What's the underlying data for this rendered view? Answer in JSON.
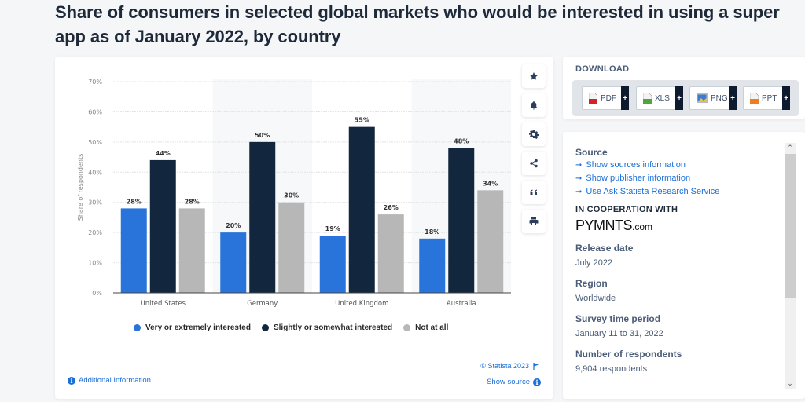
{
  "page": {
    "title": "Share of consumers in selected global markets who would be interested in using a super app as of January 2022, by country"
  },
  "chart_data": {
    "type": "bar",
    "title": "Share of consumers in selected global markets who would be interested in using a super app as of January 2022, by country",
    "xlabel": "",
    "ylabel": "Share of respondents",
    "categories": [
      "United States",
      "Germany",
      "United Kingdom",
      "Australia"
    ],
    "series": [
      {
        "name": "Very or extremely interested",
        "color": "#2874db",
        "values": [
          28,
          20,
          19,
          18
        ]
      },
      {
        "name": "Slightly or somewhat interested",
        "color": "#12263e",
        "values": [
          44,
          50,
          55,
          48
        ]
      },
      {
        "name": "Not at all",
        "color": "#b7b7b7",
        "values": [
          28,
          30,
          26,
          34
        ]
      }
    ],
    "yticks": [
      "0%",
      "10%",
      "20%",
      "30%",
      "40%",
      "50%",
      "60%",
      "70%"
    ],
    "ylim": [
      0,
      70
    ],
    "value_suffix": "%",
    "grid": true,
    "legend_position": "bottom"
  },
  "chart_footer": {
    "copyright": "© Statista 2023",
    "additional_info": "Additional Information",
    "show_source": "Show source"
  },
  "toolbar": {
    "items": [
      {
        "name": "favorite",
        "icon": "star-icon"
      },
      {
        "name": "notifications",
        "icon": "bell-icon"
      },
      {
        "name": "settings",
        "icon": "gear-icon"
      },
      {
        "name": "share",
        "icon": "share-icon"
      },
      {
        "name": "cite",
        "icon": "quote-icon"
      },
      {
        "name": "print",
        "icon": "print-icon"
      }
    ]
  },
  "download": {
    "title": "DOWNLOAD",
    "buttons": [
      {
        "label": "PDF",
        "icon": "pdf-file-icon",
        "color": "#d0262a"
      },
      {
        "label": "XLS",
        "icon": "xls-file-icon",
        "color": "#4fa53a"
      },
      {
        "label": "PNG",
        "icon": "png-image-icon",
        "color": "#3a7bd5"
      },
      {
        "label": "PPT",
        "icon": "ppt-file-icon",
        "color": "#ef7d22"
      }
    ],
    "plus_label": "+"
  },
  "info": {
    "source_heading": "Source",
    "links": [
      "Show sources information",
      "Show publisher information",
      "Use Ask Statista Research Service"
    ],
    "cooperation_heading": "IN COOPERATION WITH",
    "cooperation_logo_main": "PYMNTS",
    "cooperation_logo_suffix": ".com",
    "release_date_heading": "Release date",
    "release_date": "July 2022",
    "region_heading": "Region",
    "region": "Worldwide",
    "survey_period_heading": "Survey time period",
    "survey_period": "January 11 to 31, 2022",
    "respondents_heading": "Number of respondents",
    "respondents": "9,904 respondents"
  }
}
